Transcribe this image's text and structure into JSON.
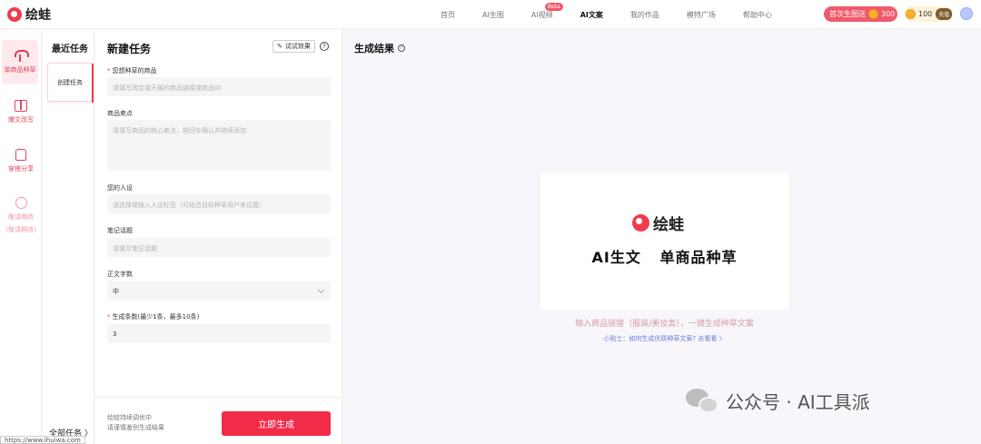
{
  "app": {
    "logo_text": "绘蛙"
  },
  "nav": {
    "items": [
      {
        "label": "首页"
      },
      {
        "label": "AI生图"
      },
      {
        "label": "AI视频",
        "badge": "Beta"
      },
      {
        "label": "AI文案",
        "active": true
      },
      {
        "label": "我的作品"
      },
      {
        "label": "模特广场"
      },
      {
        "label": "帮助中心"
      }
    ],
    "promo_label": "首次生图送",
    "promo_amount": "300",
    "points": "100",
    "recharge_label": "充值"
  },
  "rail": {
    "items": [
      {
        "label": "单商品种草",
        "icon": "sprout-icon",
        "active": true
      },
      {
        "label": "爆文改写",
        "icon": "book-icon"
      },
      {
        "label": "穿搭分享",
        "icon": "shirt-icon"
      },
      {
        "label": "敬请期待",
        "label2": "(敬请期待)",
        "icon": "chat-icon",
        "muted": true
      }
    ]
  },
  "recent": {
    "title": "最近任务",
    "card_label": "创建任务",
    "all_tasks": "全部任务 〉"
  },
  "form": {
    "title": "新建任务",
    "try_label": "试试效果",
    "help": "?",
    "product": {
      "label": "您想种草的商品",
      "placeholder": "请填写淘宝或天猫的商品链接或商品ID"
    },
    "selling_points": {
      "label": "商品卖点",
      "placeholder": "请填写商品的核心卖点，按回车确认并继续添加"
    },
    "persona": {
      "label": "您的人设",
      "placeholder": "请选择或输入人设标签（可结合目标种草用户来设置）"
    },
    "topic": {
      "label": "笔记话题",
      "placeholder": "请填写笔记话题"
    },
    "word_count": {
      "label": "正文字数",
      "value": "中"
    },
    "count": {
      "label": "生成条数(最少1条，最多10条)",
      "value": "3"
    },
    "footer_line1": "绘蛙持续调优中",
    "footer_line2": "请谨慎鉴别生成结果",
    "submit_label": "立即生成"
  },
  "result": {
    "title": "生成结果",
    "help": "?",
    "card_logo": "绘蛙",
    "card_tagline": "AI生文 单商品种草",
    "hint": "输入商品链接（服装/美妆类），一键生成种草文案",
    "tips_prefix": "小贴士：",
    "tips_link": "如何生成优质种草文案?",
    "tips_action": "去看看 〉"
  },
  "watermark": {
    "text": "公众号 · AI工具派"
  },
  "status_url": "https://www.ihuiwa.com"
}
